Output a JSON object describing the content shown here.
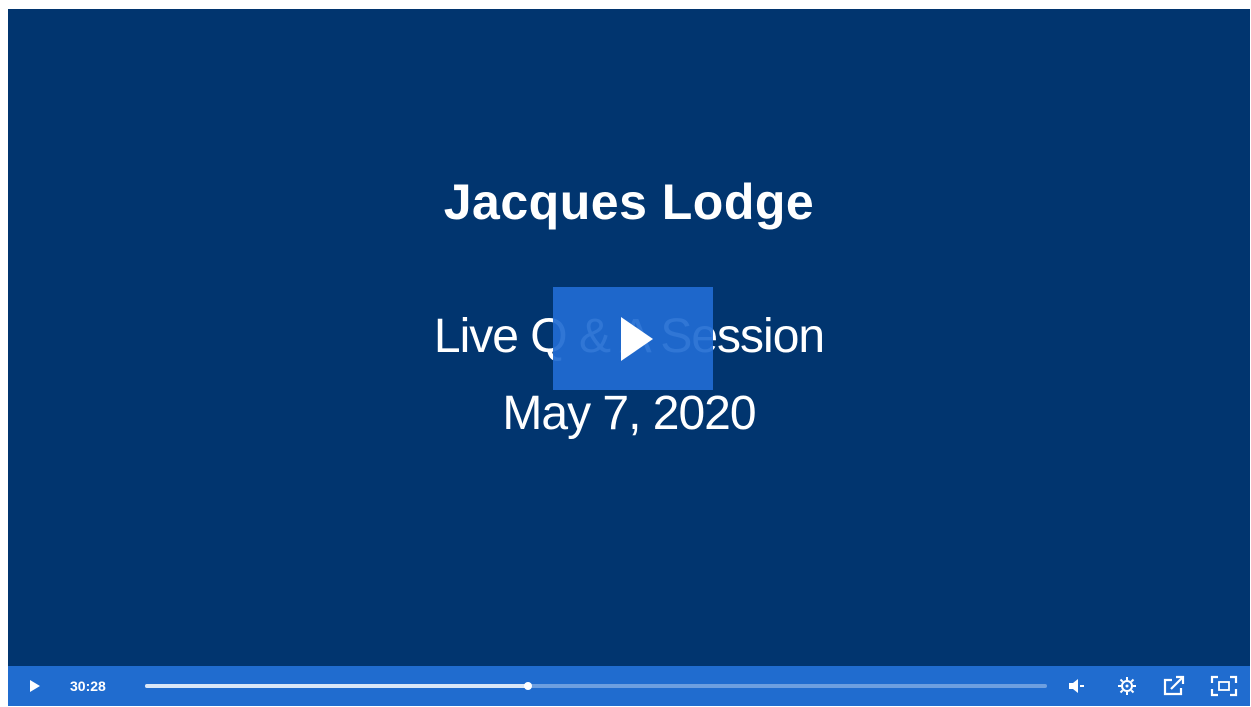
{
  "slide": {
    "title": "Jacques Lodge",
    "subtitle": "Live Q & A Session",
    "date": "May 7, 2020"
  },
  "controls": {
    "elapsed_time": "30:28",
    "progress_fraction": 0.425,
    "icons": {
      "big_play": "play-icon",
      "play": "play-icon",
      "volume": "volume-icon",
      "settings": "gear-icon",
      "share": "share-icon",
      "fullscreen": "fullscreen-icon"
    }
  },
  "colors": {
    "background": "#01356f",
    "accent": "#206ccf",
    "text": "#ffffff"
  }
}
